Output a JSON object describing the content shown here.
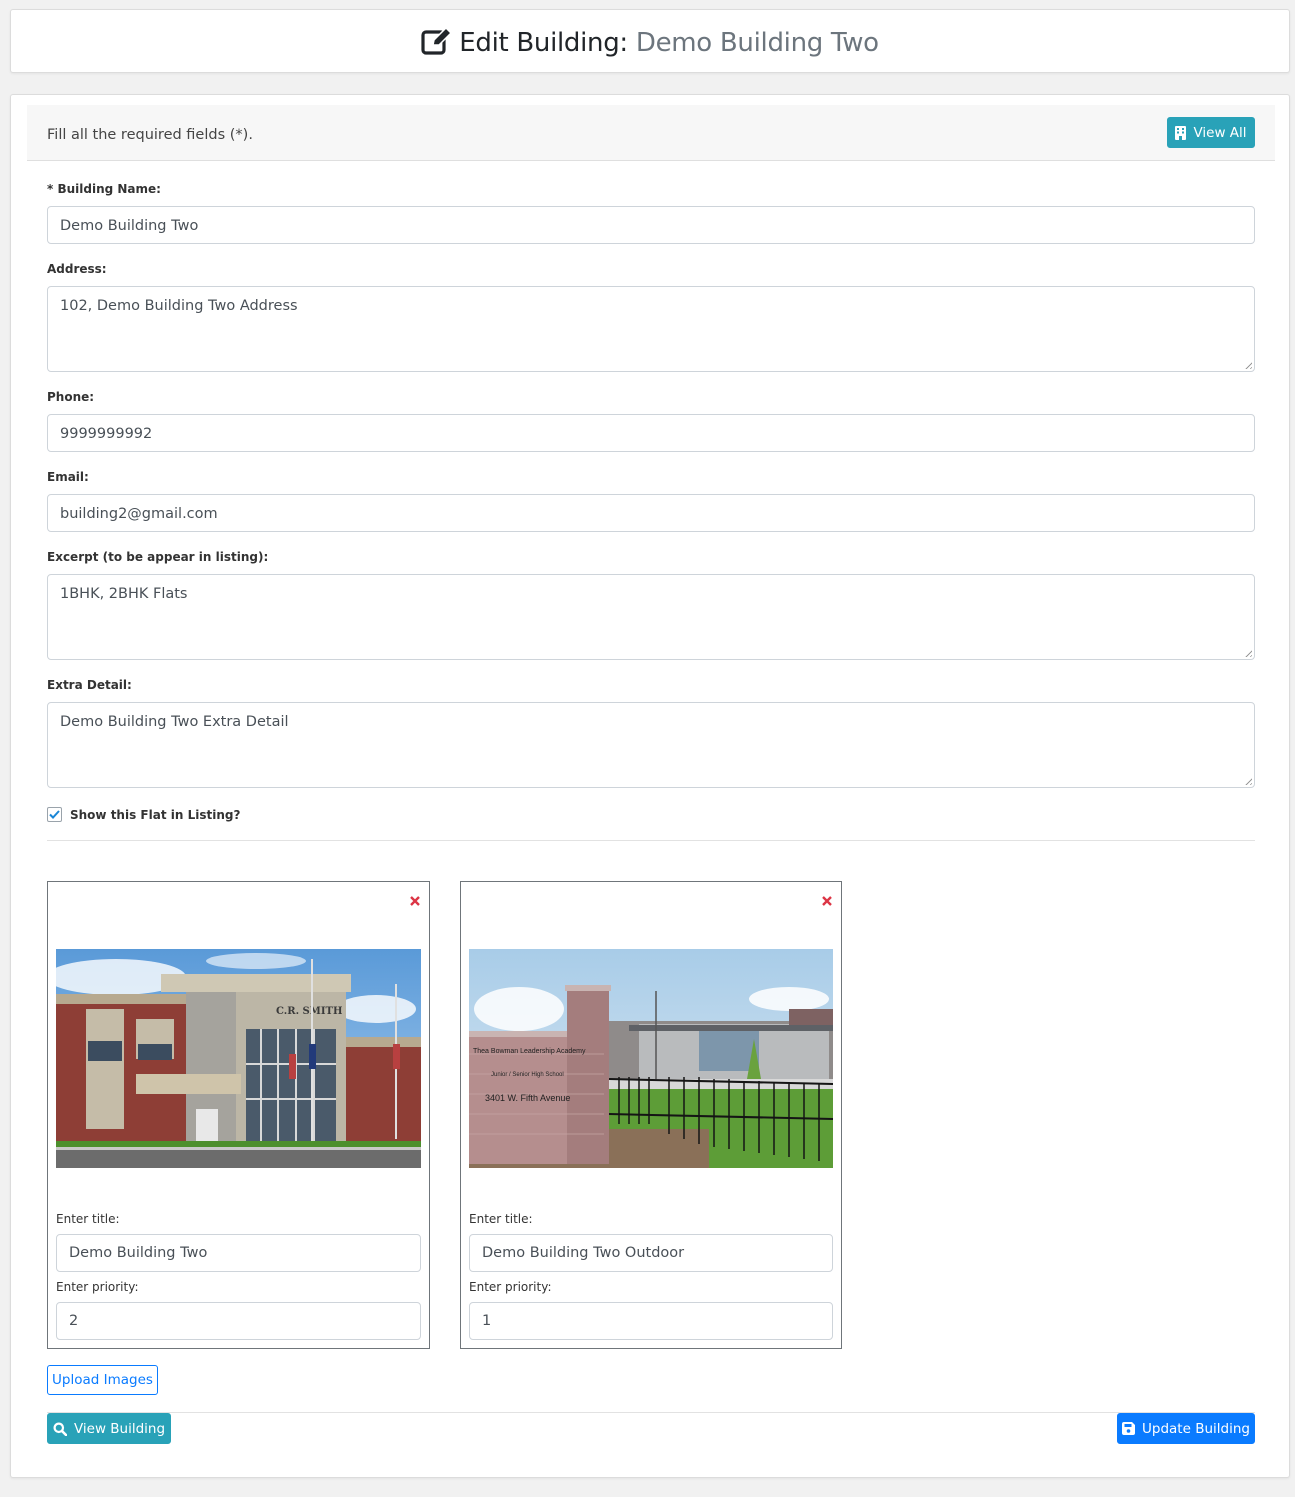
{
  "header": {
    "icon": "edit-icon",
    "title_prefix": "Edit Building:",
    "title_name": "Demo Building Two"
  },
  "form_header": {
    "hint": "Fill all the required fields (*).",
    "view_all_label": "View All",
    "view_all_icon": "building-icon"
  },
  "fields": {
    "building_name": {
      "label": "* Building Name:",
      "value": "Demo Building Two"
    },
    "address": {
      "label": "Address:",
      "value": "102, Demo Building Two Address"
    },
    "phone": {
      "label": "Phone:",
      "value": "9999999992"
    },
    "email": {
      "label": "Email:",
      "value": "building2@gmail.com"
    },
    "excerpt": {
      "label": "Excerpt (to be appear in listing):",
      "value": "1BHK, 2BHK Flats"
    },
    "extra_detail": {
      "label": "Extra Detail:",
      "value": "Demo Building Two Extra Detail"
    },
    "show_in_listing": {
      "label": "Show this Flat in Listing?",
      "checked": true
    }
  },
  "images": [
    {
      "photo_desc": "Red brick school building with 'C.R. SMITH' sign and flag poles",
      "title_label": "Enter title:",
      "title_value": "Demo Building Two",
      "priority_label": "Enter priority:",
      "priority_value": "2"
    },
    {
      "photo_desc": "Brick sign reading 'Thea Bowman Leadership Academy, Junior / Senior High School, 3401 W. Fifth Avenue' with black fence and school building",
      "title_label": "Enter title:",
      "title_value": "Demo Building Two Outdoor",
      "priority_label": "Enter priority:",
      "priority_value": "1"
    }
  ],
  "photo_text": {
    "sign1": "C.R. SMITH",
    "sign2_line1": "Thea Bowman Leadership Academy",
    "sign2_line2": "Junior / Senior High School",
    "sign2_line3": "3401 W. Fifth Avenue"
  },
  "actions": {
    "upload_label": "Upload Images",
    "view_building_label": "View Building",
    "view_building_icon": "search-icon",
    "update_label": "Update Building",
    "update_icon": "save-icon"
  },
  "colors": {
    "info": "#29a2b8",
    "primary": "#0a7bff",
    "danger": "#dc3545",
    "muted": "#6c757d"
  }
}
